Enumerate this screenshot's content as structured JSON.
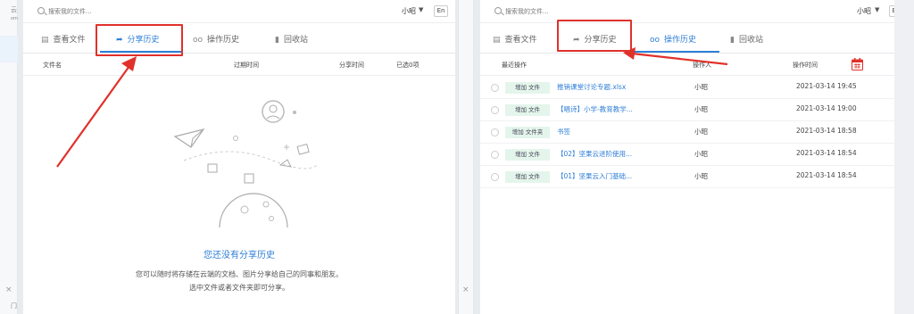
{
  "left_screen": {
    "search_placeholder": "搜索我的文件...",
    "user_name": "小昭",
    "lang_button": "En",
    "tabs": [
      {
        "icon": "file-list-icon",
        "label": "查看文件"
      },
      {
        "icon": "share-arrow-icon",
        "label": "分享历史"
      },
      {
        "icon": "glasses-icon",
        "label": "操作历史"
      },
      {
        "icon": "trash-icon",
        "label": "回收站"
      }
    ],
    "active_tab": "分享历史",
    "columns": {
      "name": "文件名",
      "expire": "过期时间",
      "share_time": "分享时间",
      "selected": "已选0项"
    },
    "empty_state": {
      "title": "您还没有分享历史",
      "line1": "您可以随时将存储在云端的文档、图片分享给自己的同事和朋友。",
      "line2": "选中文件或者文件夹即可分享。"
    }
  },
  "right_screen": {
    "search_placeholder": "搜索我的文件...",
    "user_name": "小昭",
    "lang_button": "En",
    "tabs": [
      {
        "icon": "file-list-icon",
        "label": "查看文件"
      },
      {
        "icon": "share-arrow-icon",
        "label": "分享历史"
      },
      {
        "icon": "glasses-icon",
        "label": "操作历史"
      },
      {
        "icon": "trash-icon",
        "label": "回收站"
      }
    ],
    "active_tab": "操作历史",
    "columns": {
      "recent": "最近操作",
      "operator": "操作人",
      "time": "操作时间"
    },
    "calendar_icon": "calendar-icon",
    "rows": [
      {
        "action": "增加 文件",
        "name": "推销课堂讨论专题.xlsx",
        "operator": "小昭",
        "time": "2021-03-14 19:45"
      },
      {
        "action": "增加 文件",
        "name": "【唱诗】小学-教育教学...",
        "operator": "小昭",
        "time": "2021-03-14 19:00"
      },
      {
        "action": "增加 文件夹",
        "name": "书签",
        "operator": "小昭",
        "time": "2021-03-14 18:58"
      },
      {
        "action": "增加 文件",
        "name": "【02】坚果云进阶使用...",
        "operator": "小昭",
        "time": "2021-03-14 18:54"
      },
      {
        "action": "增加 文件",
        "name": "【01】坚果云入门基础...",
        "operator": "小昭",
        "time": "2021-03-14 18:54"
      }
    ]
  },
  "edge_fragments": {
    "top": "云",
    "sub": "om",
    "bottom": "门"
  },
  "close_glyph": "×",
  "annotation_color": "#e0312a",
  "accent_color": "#2d7ed6"
}
